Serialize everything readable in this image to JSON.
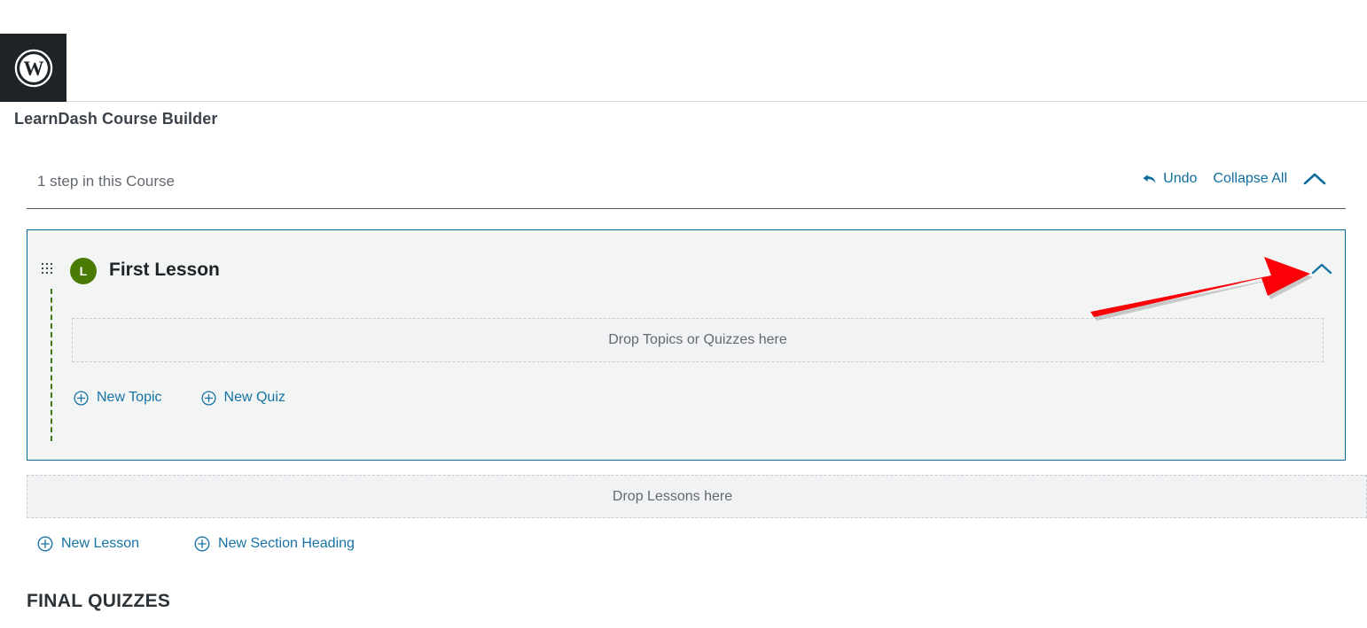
{
  "admin_bar": {
    "logo_icon": "wordpress-logo-icon"
  },
  "header": {
    "title": "LearnDash Course Builder"
  },
  "toolbar": {
    "steps_count": "1 step in this Course",
    "undo_label": "Undo",
    "undo_icon": "undo-arrow-icon",
    "collapse_all_label": "Collapse All",
    "collapse_all_icon": "chevron-up-icon"
  },
  "lesson": {
    "badge_letter": "L",
    "title": "First Lesson",
    "drag_handle_icon": "drag-handle-icon",
    "collapse_icon": "chevron-up-icon",
    "dropzone_label": "Drop Topics or Quizzes here",
    "actions": [
      {
        "label": "New Topic",
        "icon": "plus-circle-icon"
      },
      {
        "label": "New Quiz",
        "icon": "plus-circle-icon"
      }
    ]
  },
  "lessons_dropzone": {
    "label": "Drop Lessons here"
  },
  "bottom_actions": [
    {
      "label": "New Lesson",
      "icon": "plus-circle-icon"
    },
    {
      "label": "New Section Heading",
      "icon": "plus-circle-icon"
    }
  ],
  "final_quizzes": {
    "heading": "FINAL QUIZZES"
  },
  "annotation": {
    "arrow_icon": "red-arrow-pointer-icon",
    "color": "#fb0007"
  },
  "colors": {
    "link_blue": "#1673a5",
    "panel_border": "#0b6a9c",
    "lesson_badge_green": "#4a7b05",
    "tree_line_green": "#3f7a11",
    "panel_bg": "#f3f4f4",
    "dropzone_bg": "#f1f2f4",
    "admin_bar_dark": "#1d2327",
    "muted_text": "#646970"
  }
}
